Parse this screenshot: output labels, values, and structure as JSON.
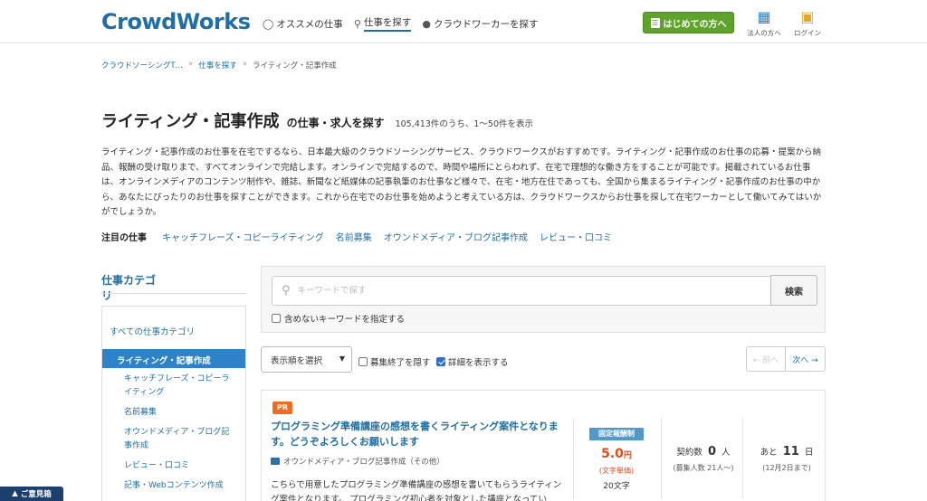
{
  "header": {
    "logo": "CrowdWorks",
    "nav": [
      {
        "icon": "lightbulb-icon",
        "label": "オススメの仕事"
      },
      {
        "icon": "search-icon",
        "label": "仕事を探す"
      },
      {
        "icon": "people-icon",
        "label": "クラウドワーカーを探す"
      }
    ],
    "beginner_button": "はじめての方へ",
    "corporate_label": "法人の方へ",
    "login_label": "ログイン"
  },
  "breadcrumb": [
    "クラウドソーシングT…",
    "仕事を探す",
    "ライティング・記事作成"
  ],
  "page": {
    "title": "ライティング・記事作成",
    "subtitle": "の仕事・求人を探す",
    "result_count": "105,413件のうち、1〜50件を表示",
    "description": "ライティング・記事作成のお仕事を在宅でするなら、日本最大級のクラウドソーシングサービス、クラウドワークスがおすすめです。ライティング・記事作成のお仕事の応募・提案から納品、報酬の受け取りまで、すべてオンラインで完結します。オンラインで完結するので、時間や場所にとらわれず、在宅で理想的な働き方をすることが可能です。掲載されているお仕事は、オンラインメディアのコンテンツ制作や、雑誌、新聞など紙媒体の記事執筆のお仕事など様々で、在宅・地方在住であっても、全国から集まるライティング・記事作成のお仕事の中から、あなたにぴったりのお仕事を探すことができます。これから在宅でのお仕事を始めようと考えている方は、クラウドワークスからお仕事を探して在宅ワーカーとして働いてみてはいかがでしょうか。",
    "featured_label": "注目の仕事",
    "featured_links": [
      "キャッチフレーズ・コピーライティング",
      "名前募集",
      "オウンドメディア・ブログ記事作成",
      "レビュー・口コミ"
    ]
  },
  "sidebar": {
    "title": "仕事カテゴリ",
    "all_categories": "すべての仕事カテゴリ",
    "active_category": "ライティング・記事作成",
    "subcategories": [
      "キャッチフレーズ・コピーライティング",
      "名前募集",
      "オウンドメディア・ブログ記事作成",
      "レビュー・口コミ",
      "記事・Webコンテンツ作成"
    ]
  },
  "search": {
    "placeholder": "キーワードで探す",
    "button": "検索",
    "exclude_label": "含めないキーワードを指定する"
  },
  "controls": {
    "sort_label": "表示順を選択",
    "hide_closed": "募集終了を隠す",
    "show_details": "詳細を表示する",
    "show_details_checked": true,
    "prev": "← 前へ",
    "next": "次へ →"
  },
  "job": {
    "badge": "PR",
    "title": "プログラミング準備講座の感想を書くライティング案件となります。どうぞよろしくお願いします",
    "category": "オウンドメディア・ブログ記事作成（その他）",
    "description": "こちらで用意したプログラミング準備講座の感想を書いてもらうライティング案件となります。 プログラミング初心者を対象とした講座となってい",
    "price_type_badge": "固定報酬制",
    "price": "5.0",
    "price_unit": "円",
    "price_note": "(文字単価)",
    "min_chars": "20文字",
    "contracts_label": "契約数",
    "contracts_value": "0",
    "contracts_unit": "人",
    "contracts_sub": "(募集人数 21人〜)",
    "deadline_prefix": "あと",
    "deadline_value": "11",
    "deadline_unit": "日",
    "deadline_sub": "(12月2日まで)"
  },
  "feedback": "ご意見箱",
  "colors": {
    "brand": "#1d6fa5",
    "beginner_button": "#5fa32c",
    "active_category": "#2d82c8",
    "price": "#e64a19",
    "pr_badge": "#f26b21",
    "feedback": "#1d3f6e"
  }
}
